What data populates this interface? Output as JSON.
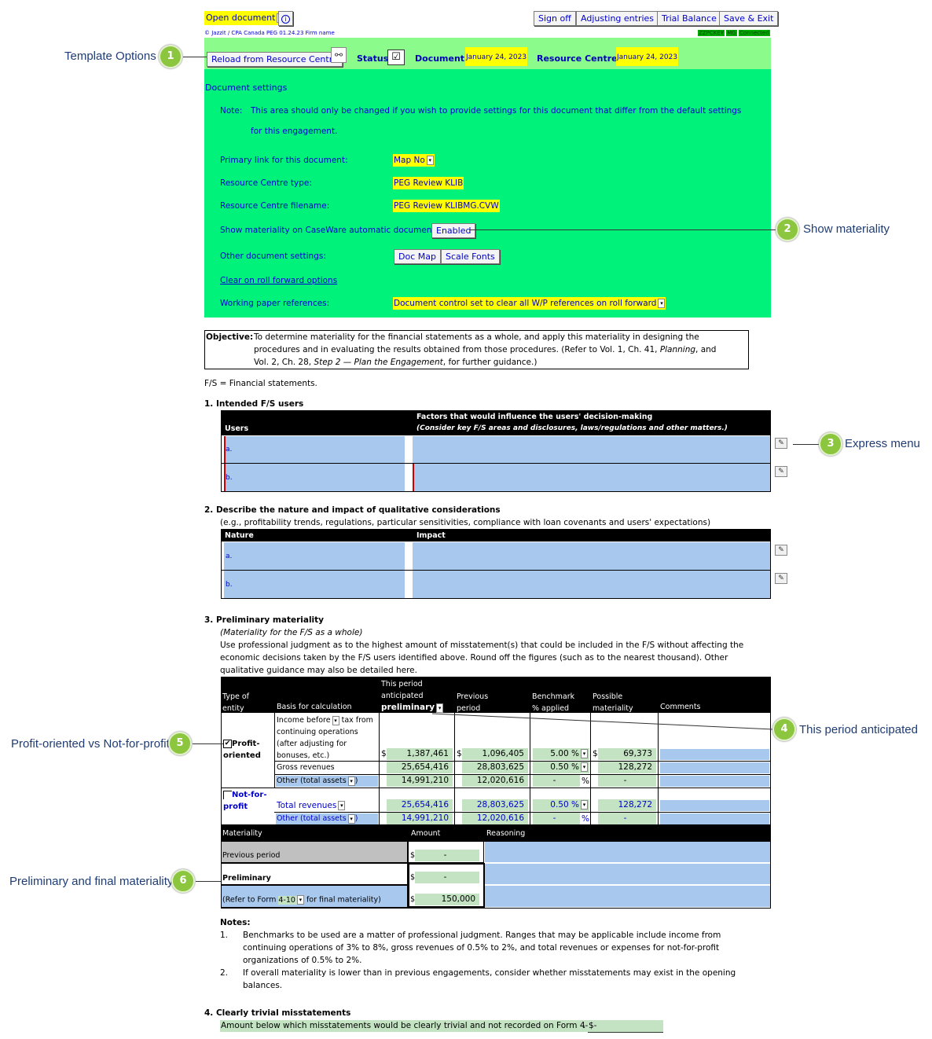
{
  "toolbar": {
    "open_document": "Open document",
    "info_icon": "info-icon",
    "sign_off": "Sign off",
    "adjusting_entries": "Adjusting entries",
    "trial_balance": "Trial Balance",
    "save_exit": "Save & Exit",
    "firm_line": "© Jazzit / CPA Canada PEG 01.24.23 Firm name",
    "status_tags": [
      "ZZPCKEY",
      "MG",
      "Connected"
    ]
  },
  "template": {
    "reload_button": "Reload from Resource Centre",
    "status_label": "Status:",
    "document_label": "Document :",
    "document_date": "January 24, 2023",
    "resource_label": "Resource Centre :",
    "resource_date": "January 24, 2023"
  },
  "settings": {
    "title": "Document settings",
    "note_label": "Note:",
    "note_line1": "This area should only be changed if you wish to provide settings for this document that differ from the default settings",
    "note_line2": "for this engagement.",
    "primary_link_label": "Primary link for this document:",
    "primary_link_value": "Map No",
    "rc_type_label": "Resource Centre type:",
    "rc_type_value": "PEG Review KLIB",
    "rc_filename_label": "Resource Centre filename:",
    "rc_filename_value": "PEG Review KLIBMG.CVW",
    "show_mat_label": "Show materiality on CaseWare automatic documents:",
    "show_mat_button": "Enabled",
    "other_label": "Other document settings:",
    "doc_map_button": "Doc Map",
    "scale_fonts_button": "Scale Fonts",
    "clear_link": "Clear on roll forward options",
    "wp_label": "Working paper references:",
    "wp_value": "Document control set to clear all W/P references on roll forward"
  },
  "objective": {
    "label": "Objective:",
    "line1": "To determine materiality for the financial statements as a whole, and apply this materiality in designing the",
    "line2": "procedures and in evaluating the results obtained from those procedures. (Refer to Vol. 1, Ch. 41, ",
    "line2_italic": "Planning",
    "line2_end": ", and",
    "line3": "Vol. 2, Ch. 28, ",
    "line3_italic": "Step 2 — Plan the Engagement",
    "line3_end": ", for further guidance.)"
  },
  "fs_def": "F/S = Financial statements.",
  "section1": {
    "title": "1.   Intended F/S users",
    "col_users": "Users",
    "col_factors": "Factors that would influence the users' decision-making",
    "col_factors_sub": "(Consider key F/S areas and disclosures, laws/regulations and other matters.)",
    "rows": [
      "a.",
      "b."
    ]
  },
  "section2": {
    "title": "2.   Describe the nature and impact of qualitative considerations",
    "subtitle": "(e.g., profitability trends, regulations, particular sensitivities, compliance with loan covenants and users' expectations)",
    "col_nature": "Nature",
    "col_impact": "Impact",
    "rows": [
      "a.",
      "b."
    ]
  },
  "section3": {
    "title": "3.   Preliminary materiality",
    "sub_italic": "(Materiality for the F/S as a whole)",
    "para1": "Use professional judgment as to the highest amount of misstatement(s) that could be included in the F/S without affecting the",
    "para2": "economic decisions taken by the F/S users identified above. Round off the figures (such as to the nearest thousand). Other",
    "para3": "qualitative guidance may also be detailed here.",
    "hdr_type": [
      "Type of",
      "entity"
    ],
    "hdr_basis": "Basis for calculation",
    "hdr_this": [
      "This period",
      "anticipated",
      "preliminary"
    ],
    "hdr_prev": [
      "Previous",
      "period"
    ],
    "hdr_bench": [
      "Benchmark",
      "% applied"
    ],
    "hdr_possible": [
      "Possible",
      "materiality"
    ],
    "hdr_comments": "Comments",
    "profit_label": [
      "Profit-",
      "oriented"
    ],
    "nfp_label": [
      "Not-for-",
      "profit"
    ],
    "income_basis": [
      "Income before",
      "tax from",
      "continuing operations",
      "(after adjusting for",
      "bonuses, etc.)"
    ],
    "rows_profit": [
      {
        "basis": "income",
        "this": "1,387,461",
        "prev": "1,096,405",
        "bench": "5.00",
        "possible": "69,373"
      },
      {
        "basis": "Gross revenues",
        "this": "25,654,416",
        "prev": "28,803,625",
        "bench": "0.50",
        "possible": "128,272"
      },
      {
        "basis": "Other (total assets",
        "this": "14,991,210",
        "prev": "12,020,616",
        "bench": "-",
        "possible": "-"
      }
    ],
    "rows_nfp": [
      {
        "basis": "Total revenues",
        "this": "25,654,416",
        "prev": "28,803,625",
        "bench": "0.50",
        "possible": "128,272"
      },
      {
        "basis": "Other (total assets",
        "this": "14,991,210",
        "prev": "12,020,616",
        "bench": "-",
        "possible": "-"
      }
    ],
    "dollar": "$",
    "pct": "%",
    "close_paren": ")",
    "mat_hdr": "Materiality",
    "amount_hdr": "Amount",
    "reasoning_hdr": "Reasoning",
    "prev_period": "Previous period",
    "prev_amount": "-",
    "preliminary": "Preliminary",
    "prelim_amount": "-",
    "refer_pre": "(Refer to Form ",
    "refer_form": "4-10",
    "refer_post": " for final materiality)",
    "final_amount": "150,000"
  },
  "notes": {
    "title": "Notes:",
    "n1_num": "1.",
    "n1": [
      "Benchmarks to be used are a matter of professional judgment. Ranges that may be applicable include income from",
      "continuing operations of 3% to 8%, gross revenues of 0.5% to 2%, and total revenues or expenses for not-for-profit",
      "organizations of 0.5% to 2%."
    ],
    "n2_num": "2.",
    "n2": [
      "If overall materiality is lower than in previous engagements, consider whether misstatements may exist in the opening",
      "balances."
    ]
  },
  "section4": {
    "title": "4.   Clearly trivial misstatements",
    "text": "Amount below which misstatements would be clearly trivial and not recorded on Form 4-10",
    "amount": "$-"
  },
  "callouts": [
    {
      "num": "1",
      "text": "Template Options"
    },
    {
      "num": "2",
      "text": "Show materiality"
    },
    {
      "num": "3",
      "text": "Express menu"
    },
    {
      "num": "4",
      "text": "This period anticipated"
    },
    {
      "num": "5",
      "text": "Profit-oriented vs Not-for-profit"
    },
    {
      "num": "6",
      "text": "Preliminary and final materiality"
    }
  ],
  "colors": {
    "topbar": "#8bfb8b",
    "settings": "#00f27a",
    "input_blue": "#a9c8ee",
    "calc_green": "#c3e3c3",
    "highlight": "#ffff00",
    "callout": "#8cc63e"
  }
}
